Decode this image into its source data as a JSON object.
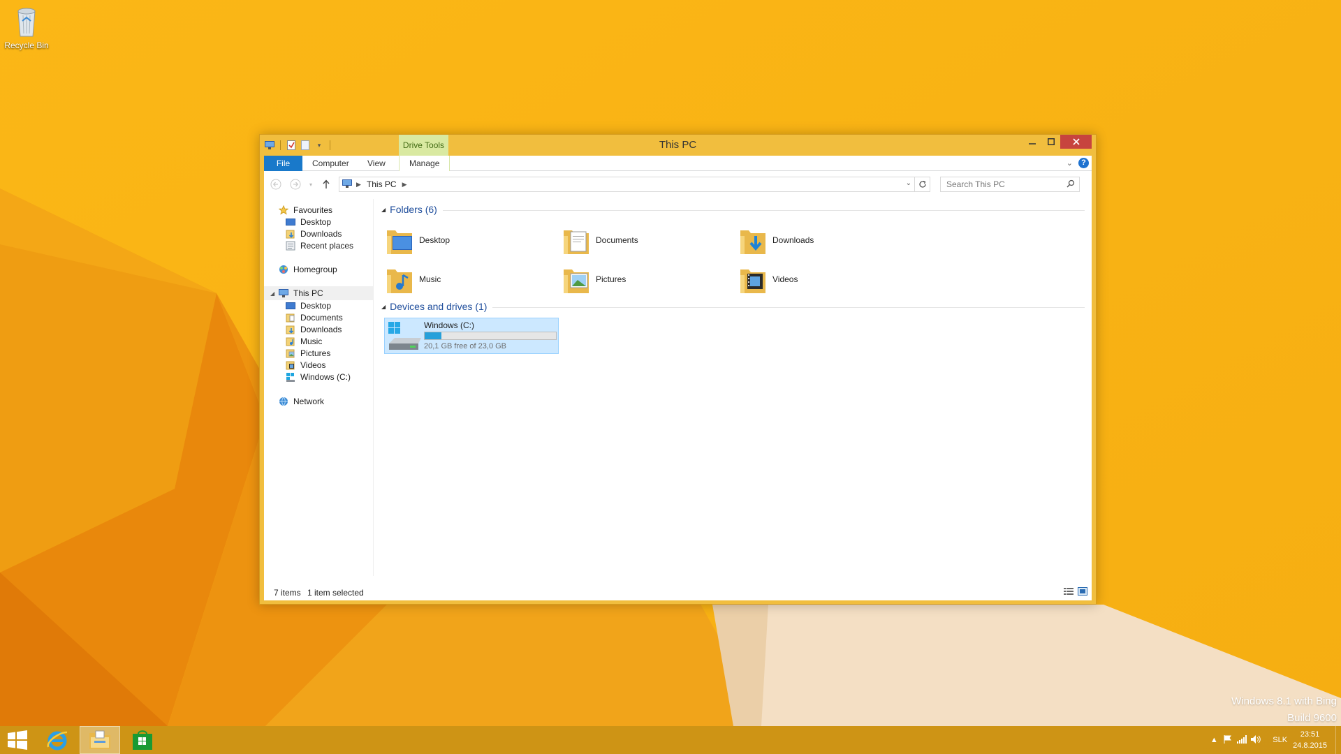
{
  "desktop": {
    "recycle_bin_label": "Recycle Bin",
    "watermark_line1": "Windows 8.1 with Bing",
    "watermark_line2": "Build 9600"
  },
  "window": {
    "title": "This PC",
    "contextual_tab": "Drive Tools",
    "ribbon_tabs": {
      "file": "File",
      "computer": "Computer",
      "view": "View",
      "manage": "Manage"
    },
    "address": {
      "crumb": "This PC"
    },
    "search_placeholder": "Search This PC",
    "nav": {
      "favourites": "Favourites",
      "fav_desktop": "Desktop",
      "fav_downloads": "Downloads",
      "fav_recent": "Recent places",
      "homegroup": "Homegroup",
      "this_pc": "This PC",
      "pc_desktop": "Desktop",
      "pc_documents": "Documents",
      "pc_downloads": "Downloads",
      "pc_music": "Music",
      "pc_pictures": "Pictures",
      "pc_videos": "Videos",
      "pc_windows": "Windows (C:)",
      "network": "Network"
    },
    "groups": {
      "folders": "Folders (6)",
      "devices": "Devices and drives (1)"
    },
    "folders": [
      {
        "label": "Desktop",
        "icon": "desktop-folder-icon"
      },
      {
        "label": "Documents",
        "icon": "documents-folder-icon"
      },
      {
        "label": "Downloads",
        "icon": "downloads-folder-icon"
      },
      {
        "label": "Music",
        "icon": "music-folder-icon"
      },
      {
        "label": "Pictures",
        "icon": "pictures-folder-icon"
      },
      {
        "label": "Videos",
        "icon": "videos-folder-icon"
      }
    ],
    "drive": {
      "name": "Windows (C:)",
      "free_text": "20,1 GB free of 23,0 GB",
      "used_fraction": 0.126
    },
    "status": {
      "items": "7 items",
      "selected": "1 item selected"
    }
  },
  "taskbar": {
    "language": "SLK",
    "time": "23:51",
    "date": "24.8.2015"
  },
  "colors": {
    "accent": "#1979ca",
    "window_frame": "#f1be3e",
    "selection": "#cce8ff",
    "close_button": "#c7443e"
  }
}
